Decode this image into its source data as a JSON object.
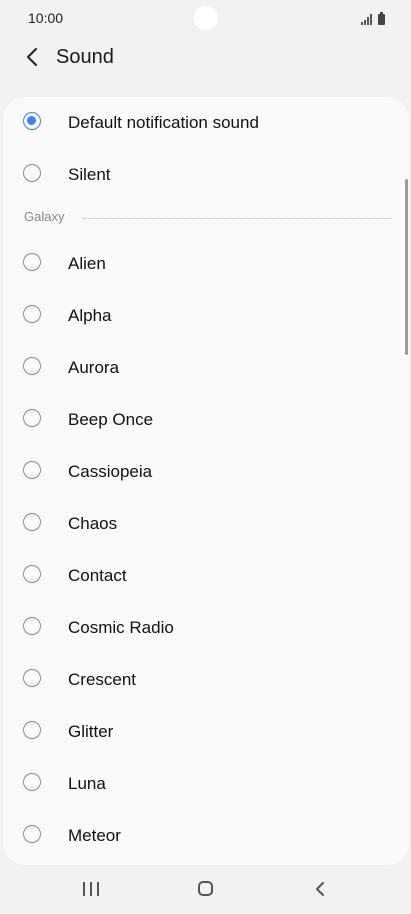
{
  "status_bar": {
    "time": "10:00"
  },
  "header": {
    "title": "Sound",
    "back_icon": "chevron-left-icon"
  },
  "options_top": [
    {
      "label": "Default notification sound",
      "selected": true
    },
    {
      "label": "Silent",
      "selected": false
    }
  ],
  "section": {
    "title": "Galaxy"
  },
  "galaxy_sounds": [
    {
      "label": "Alien"
    },
    {
      "label": "Alpha"
    },
    {
      "label": "Aurora"
    },
    {
      "label": "Beep Once"
    },
    {
      "label": "Cassiopeia"
    },
    {
      "label": "Chaos"
    },
    {
      "label": "Contact"
    },
    {
      "label": "Cosmic Radio"
    },
    {
      "label": "Crescent"
    },
    {
      "label": "Glitter"
    },
    {
      "label": "Luna"
    },
    {
      "label": "Meteor"
    }
  ],
  "nav_bar": {
    "recent_icon": "recent-apps-icon",
    "home_icon": "home-icon",
    "back_icon": "back-icon"
  },
  "colors": {
    "accent": "#3e82f7",
    "background": "#f2f2f2",
    "card": "#fafafa"
  }
}
